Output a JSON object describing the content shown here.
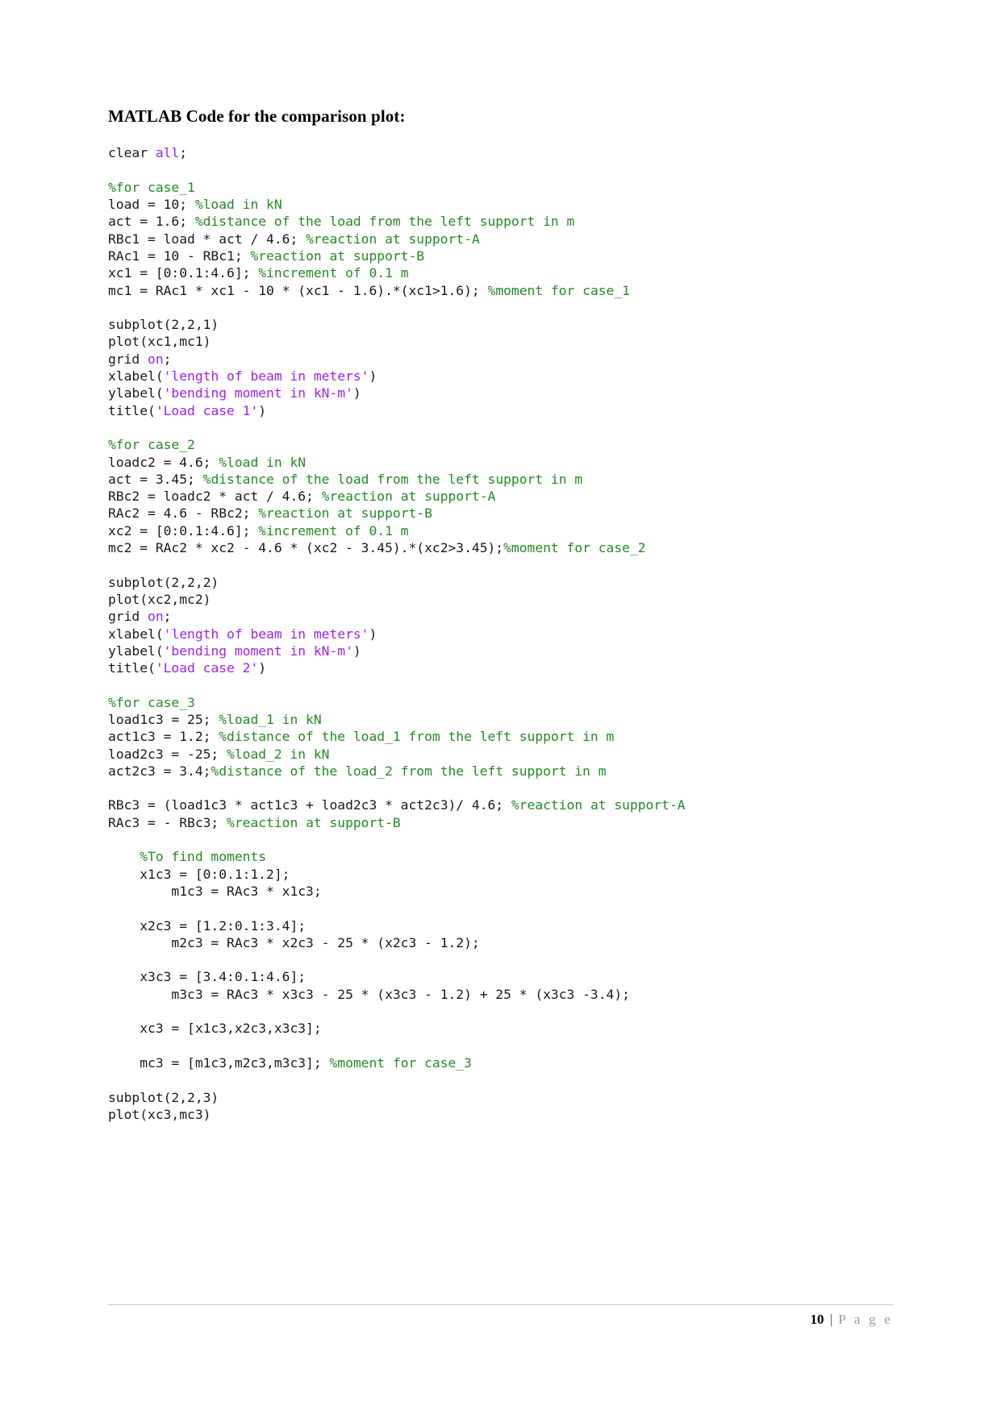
{
  "document": {
    "heading": "MATLAB Code for the comparison plot:",
    "footer": {
      "page_number": "10",
      "separator": "|",
      "page_word": "P a g e"
    },
    "colors": {
      "comment": "#228B22",
      "string": "#A020F0",
      "plain": "#1a1a1a",
      "footer_gray": "#9a9a9a",
      "rule": "#c9c9c9"
    }
  },
  "code": {
    "language": "matlab",
    "lines": [
      {
        "id": 1,
        "tokens": [
          {
            "t": "plain",
            "v": "clear "
          },
          {
            "t": "keyword",
            "v": "all"
          },
          {
            "t": "plain",
            "v": ";"
          }
        ]
      },
      {
        "id": 2,
        "tokens": []
      },
      {
        "id": 3,
        "tokens": [
          {
            "t": "comment",
            "v": "%for case_1"
          }
        ]
      },
      {
        "id": 4,
        "tokens": [
          {
            "t": "plain",
            "v": "load = 10; "
          },
          {
            "t": "comment",
            "v": "%load in kN"
          }
        ]
      },
      {
        "id": 5,
        "tokens": [
          {
            "t": "plain",
            "v": "act = 1.6; "
          },
          {
            "t": "comment",
            "v": "%distance of the load from the left support in m"
          }
        ]
      },
      {
        "id": 6,
        "tokens": [
          {
            "t": "plain",
            "v": "RBc1 = load * act / 4.6; "
          },
          {
            "t": "comment",
            "v": "%reaction at support-A"
          }
        ]
      },
      {
        "id": 7,
        "tokens": [
          {
            "t": "plain",
            "v": "RAc1 = 10 - RBc1; "
          },
          {
            "t": "comment",
            "v": "%reaction at support-B"
          }
        ]
      },
      {
        "id": 8,
        "tokens": [
          {
            "t": "plain",
            "v": "xc1 = [0:0.1:4.6]; "
          },
          {
            "t": "comment",
            "v": "%increment of 0.1 m"
          }
        ]
      },
      {
        "id": 9,
        "tokens": [
          {
            "t": "plain",
            "v": "mc1 = RAc1 * xc1 - 10 * (xc1 - 1.6).*(xc1>1.6); "
          },
          {
            "t": "comment",
            "v": "%moment for case_1"
          }
        ]
      },
      {
        "id": 10,
        "tokens": []
      },
      {
        "id": 11,
        "tokens": [
          {
            "t": "plain",
            "v": "subplot(2,2,1)"
          }
        ]
      },
      {
        "id": 12,
        "tokens": [
          {
            "t": "plain",
            "v": "plot(xc1,mc1)"
          }
        ]
      },
      {
        "id": 13,
        "tokens": [
          {
            "t": "plain",
            "v": "grid "
          },
          {
            "t": "keyword",
            "v": "on"
          },
          {
            "t": "plain",
            "v": ";"
          }
        ]
      },
      {
        "id": 14,
        "tokens": [
          {
            "t": "plain",
            "v": "xlabel("
          },
          {
            "t": "string",
            "v": "'length of beam in meters'"
          },
          {
            "t": "plain",
            "v": ")"
          }
        ]
      },
      {
        "id": 15,
        "tokens": [
          {
            "t": "plain",
            "v": "ylabel("
          },
          {
            "t": "string",
            "v": "'bending moment in kN-m'"
          },
          {
            "t": "plain",
            "v": ")"
          }
        ]
      },
      {
        "id": 16,
        "tokens": [
          {
            "t": "plain",
            "v": "title("
          },
          {
            "t": "string",
            "v": "'Load case 1'"
          },
          {
            "t": "plain",
            "v": ")"
          }
        ]
      },
      {
        "id": 17,
        "tokens": []
      },
      {
        "id": 18,
        "tokens": [
          {
            "t": "comment",
            "v": "%for case_2"
          }
        ]
      },
      {
        "id": 19,
        "tokens": [
          {
            "t": "plain",
            "v": "loadc2 = 4.6; "
          },
          {
            "t": "comment",
            "v": "%load in kN"
          }
        ]
      },
      {
        "id": 20,
        "tokens": [
          {
            "t": "plain",
            "v": "act = 3.45; "
          },
          {
            "t": "comment",
            "v": "%distance of the load from the left support in m"
          }
        ]
      },
      {
        "id": 21,
        "tokens": [
          {
            "t": "plain",
            "v": "RBc2 = loadc2 * act / 4.6; "
          },
          {
            "t": "comment",
            "v": "%reaction at support-A"
          }
        ]
      },
      {
        "id": 22,
        "tokens": [
          {
            "t": "plain",
            "v": "RAc2 = 4.6 - RBc2; "
          },
          {
            "t": "comment",
            "v": "%reaction at support-B"
          }
        ]
      },
      {
        "id": 23,
        "tokens": [
          {
            "t": "plain",
            "v": "xc2 = [0:0.1:4.6]; "
          },
          {
            "t": "comment",
            "v": "%increment of 0.1 m"
          }
        ]
      },
      {
        "id": 24,
        "tokens": [
          {
            "t": "plain",
            "v": "mc2 = RAc2 * xc2 - 4.6 * (xc2 - 3.45).*(xc2>3.45);"
          },
          {
            "t": "comment",
            "v": "%moment for case_2"
          }
        ]
      },
      {
        "id": 25,
        "tokens": []
      },
      {
        "id": 26,
        "tokens": [
          {
            "t": "plain",
            "v": "subplot(2,2,2)"
          }
        ]
      },
      {
        "id": 27,
        "tokens": [
          {
            "t": "plain",
            "v": "plot(xc2,mc2)"
          }
        ]
      },
      {
        "id": 28,
        "tokens": [
          {
            "t": "plain",
            "v": "grid "
          },
          {
            "t": "keyword",
            "v": "on"
          },
          {
            "t": "plain",
            "v": ";"
          }
        ]
      },
      {
        "id": 29,
        "tokens": [
          {
            "t": "plain",
            "v": "xlabel("
          },
          {
            "t": "string",
            "v": "'length of beam in meters'"
          },
          {
            "t": "plain",
            "v": ")"
          }
        ]
      },
      {
        "id": 30,
        "tokens": [
          {
            "t": "plain",
            "v": "ylabel("
          },
          {
            "t": "string",
            "v": "'bending moment in kN-m'"
          },
          {
            "t": "plain",
            "v": ")"
          }
        ]
      },
      {
        "id": 31,
        "tokens": [
          {
            "t": "plain",
            "v": "title("
          },
          {
            "t": "string",
            "v": "'Load case 2'"
          },
          {
            "t": "plain",
            "v": ")"
          }
        ]
      },
      {
        "id": 32,
        "tokens": []
      },
      {
        "id": 33,
        "tokens": [
          {
            "t": "comment",
            "v": "%for case_3"
          }
        ]
      },
      {
        "id": 34,
        "tokens": [
          {
            "t": "plain",
            "v": "load1c3 = 25; "
          },
          {
            "t": "comment",
            "v": "%load_1 in kN"
          }
        ]
      },
      {
        "id": 35,
        "tokens": [
          {
            "t": "plain",
            "v": "act1c3 = 1.2; "
          },
          {
            "t": "comment",
            "v": "%distance of the load_1 from the left support in m"
          }
        ]
      },
      {
        "id": 36,
        "tokens": [
          {
            "t": "plain",
            "v": "load2c3 = -25; "
          },
          {
            "t": "comment",
            "v": "%load_2 in kN"
          }
        ]
      },
      {
        "id": 37,
        "tokens": [
          {
            "t": "plain",
            "v": "act2c3 = 3.4;"
          },
          {
            "t": "comment",
            "v": "%distance of the load_2 from the left support in m"
          }
        ]
      },
      {
        "id": 38,
        "tokens": []
      },
      {
        "id": 39,
        "tokens": [
          {
            "t": "plain",
            "v": "RBc3 = (load1c3 * act1c3 + load2c3 * act2c3)/ 4.6; "
          },
          {
            "t": "comment",
            "v": "%reaction at support-A"
          }
        ]
      },
      {
        "id": 40,
        "tokens": [
          {
            "t": "plain",
            "v": "RAc3 = - RBc3; "
          },
          {
            "t": "comment",
            "v": "%reaction at support-B"
          }
        ]
      },
      {
        "id": 41,
        "tokens": []
      },
      {
        "id": 42,
        "tokens": [
          {
            "t": "comment",
            "v": "    %To find moments"
          }
        ]
      },
      {
        "id": 43,
        "tokens": [
          {
            "t": "plain",
            "v": "    x1c3 = [0:0.1:1.2];"
          }
        ]
      },
      {
        "id": 44,
        "tokens": [
          {
            "t": "plain",
            "v": "        m1c3 = RAc3 * x1c3;"
          }
        ]
      },
      {
        "id": 45,
        "tokens": []
      },
      {
        "id": 46,
        "tokens": [
          {
            "t": "plain",
            "v": "    x2c3 = [1.2:0.1:3.4];"
          }
        ]
      },
      {
        "id": 47,
        "tokens": [
          {
            "t": "plain",
            "v": "        m2c3 = RAc3 * x2c3 - 25 * (x2c3 - 1.2);"
          }
        ]
      },
      {
        "id": 48,
        "tokens": []
      },
      {
        "id": 49,
        "tokens": [
          {
            "t": "plain",
            "v": "    x3c3 = [3.4:0.1:4.6];"
          }
        ]
      },
      {
        "id": 50,
        "tokens": [
          {
            "t": "plain",
            "v": "        m3c3 = RAc3 * x3c3 - 25 * (x3c3 - 1.2) + 25 * (x3c3 -3.4);"
          }
        ]
      },
      {
        "id": 51,
        "tokens": []
      },
      {
        "id": 52,
        "tokens": [
          {
            "t": "plain",
            "v": "    xc3 = [x1c3,x2c3,x3c3];"
          }
        ]
      },
      {
        "id": 53,
        "tokens": []
      },
      {
        "id": 54,
        "tokens": [
          {
            "t": "plain",
            "v": "    mc3 = [m1c3,m2c3,m3c3]; "
          },
          {
            "t": "comment",
            "v": "%moment for case_3"
          }
        ]
      },
      {
        "id": 55,
        "tokens": []
      },
      {
        "id": 56,
        "tokens": [
          {
            "t": "plain",
            "v": "subplot(2,2,3)"
          }
        ]
      },
      {
        "id": 57,
        "tokens": [
          {
            "t": "plain",
            "v": "plot(xc3,mc3)"
          }
        ]
      }
    ]
  }
}
